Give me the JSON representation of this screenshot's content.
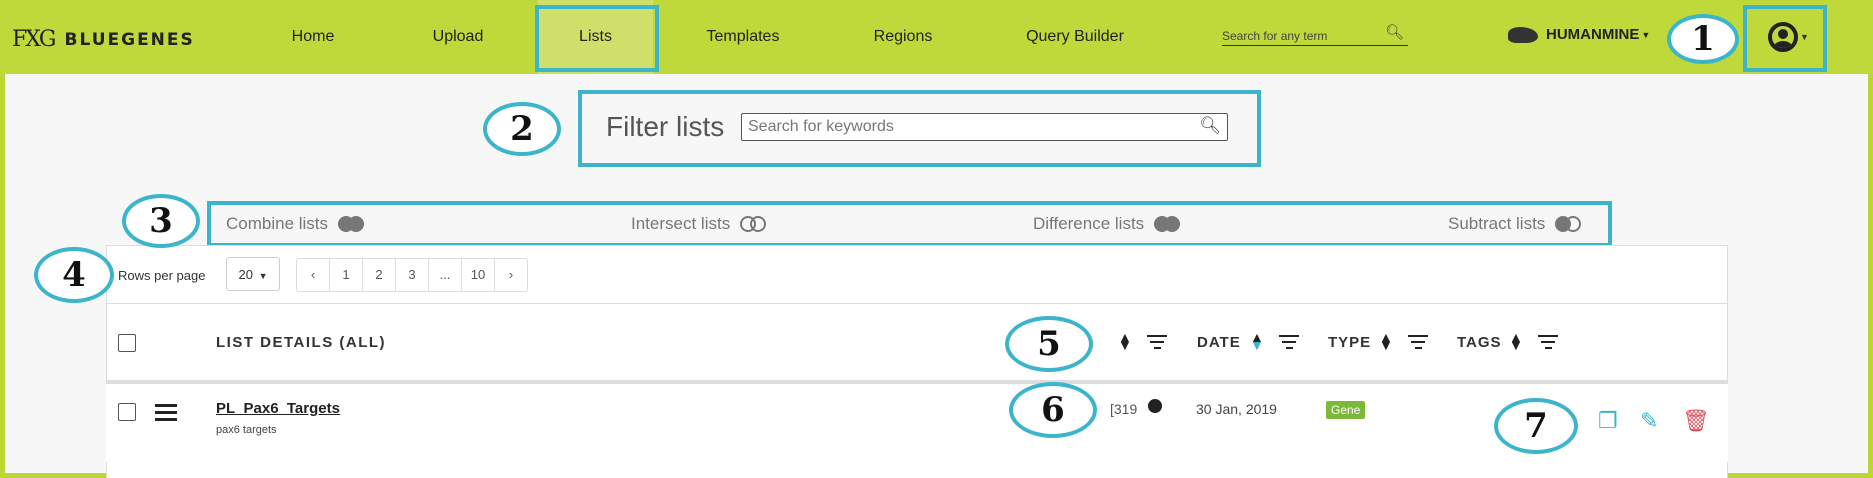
{
  "app": {
    "logo_mark": "FXG",
    "name": "BLUEGENES"
  },
  "nav": {
    "items": [
      "Home",
      "Upload",
      "Lists",
      "Templates",
      "Regions",
      "Query Builder"
    ],
    "active": "Lists",
    "search_placeholder": "Search for any term",
    "mine": "HUMANMINE"
  },
  "annotations": [
    "1",
    "2",
    "3",
    "4",
    "5",
    "6",
    "7"
  ],
  "filter": {
    "title": "Filter lists",
    "placeholder": "Search for keywords"
  },
  "operations": [
    "Combine lists",
    "Intersect lists",
    "Difference lists",
    "Subtract lists"
  ],
  "pagination": {
    "rows_label": "Rows per page",
    "rows_value": "20",
    "pages": [
      "‹",
      "1",
      "2",
      "3",
      "...",
      "10",
      "›"
    ]
  },
  "table": {
    "header_title": "LIST DETAILS (ALL)",
    "columns": [
      "DATE",
      "TYPE",
      "TAGS"
    ],
    "rows": [
      {
        "name": "PL_Pax6_Targets",
        "description": "pax6 targets",
        "count": "[319",
        "date": "30 Jan, 2019",
        "type": "Gene"
      }
    ]
  },
  "colors": {
    "nav_bg": "#bfd83a",
    "active_tab": "#cfe06a",
    "annotation": "#3cb5cc",
    "action_copy": "#3cb5cc",
    "action_delete": "#e04e5a",
    "tag_gene": "#7cb83a"
  },
  "icons": {
    "search": "search-icon",
    "user": "user-icon",
    "list": "list-icon",
    "globe": "globe-icon",
    "copy": "copy-icon",
    "edit": "edit-icon",
    "delete": "trash-icon"
  }
}
